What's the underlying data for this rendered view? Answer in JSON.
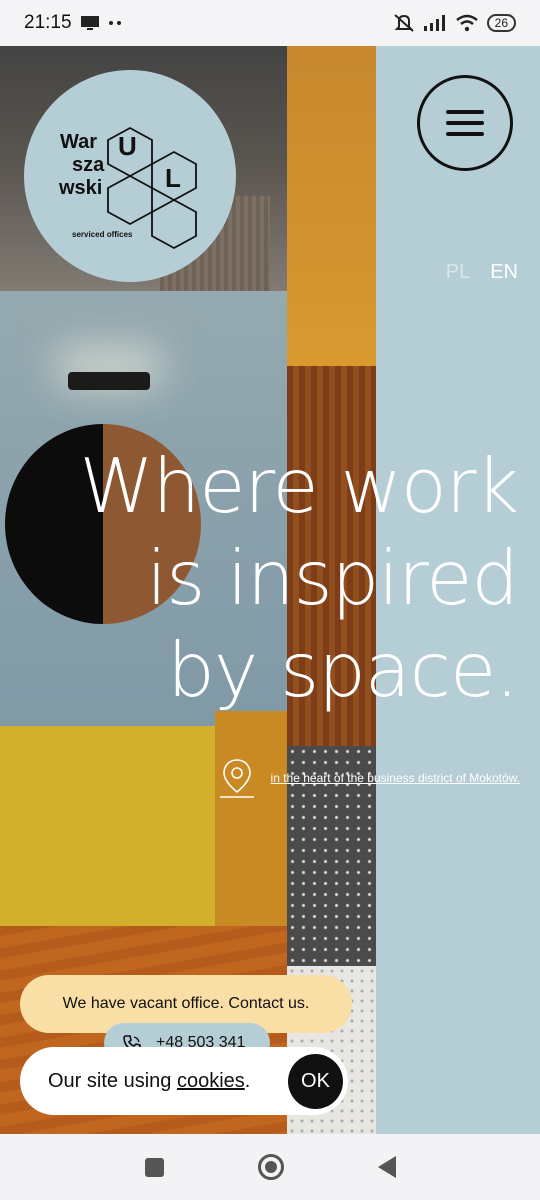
{
  "status_bar": {
    "time": "21:15",
    "battery": "26",
    "icons": [
      "monitor-icon",
      "dots-icon",
      "mute-icon",
      "signal-icon",
      "wifi-icon",
      "battery-icon"
    ]
  },
  "logo": {
    "word_lines": [
      "War",
      "sza",
      "wski"
    ],
    "letters": [
      "U",
      "L"
    ],
    "subtitle": "serviced offices"
  },
  "menu": {
    "icon": "hamburger-icon"
  },
  "language": {
    "pl": "PL",
    "en": "EN"
  },
  "headline": {
    "line1": "Where work",
    "line2": "is inspired",
    "line3": "by space."
  },
  "location": {
    "icon": "map-pin-icon",
    "text": "in the heart of the business district of Mokotów."
  },
  "vacancy": {
    "text": "We have vacant office. Contact us."
  },
  "phone": {
    "icon": "phone-icon",
    "number": "+48 503 341"
  },
  "cookie": {
    "text": "Our site using ",
    "link": "cookies",
    "suffix": ".",
    "ok_label": "OK"
  },
  "colors": {
    "accent_blue": "#b5ced6",
    "vacancy_yellow": "#f9dea5",
    "text_dark": "#111111",
    "headline_white": "#ffffff"
  }
}
